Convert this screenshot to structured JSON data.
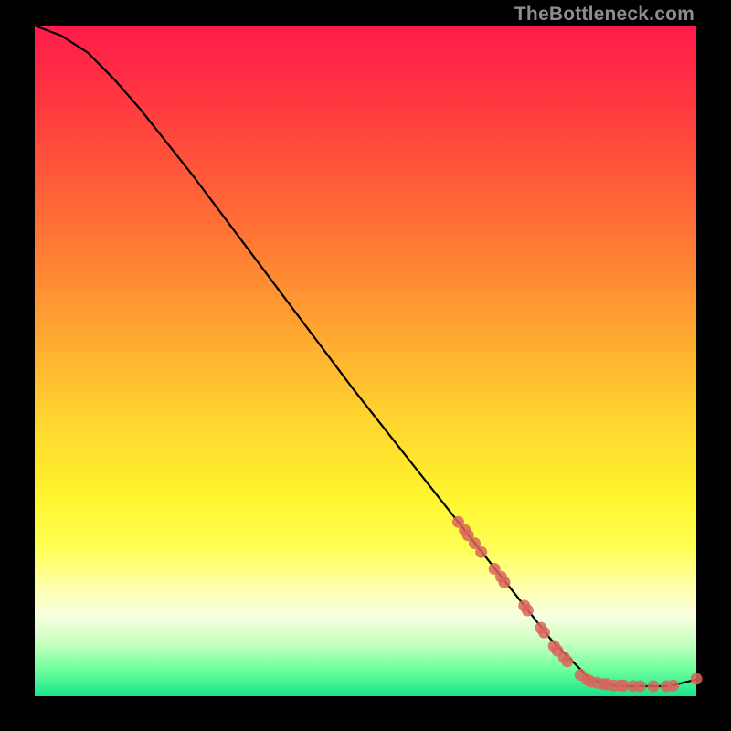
{
  "watermark": "TheBottleneck.com",
  "colors": {
    "curve": "#000000",
    "point": "#d9655a",
    "frame": "#000000"
  },
  "chart_data": {
    "type": "line",
    "title": "",
    "xlabel": "",
    "ylabel": "",
    "xlim": [
      0,
      100
    ],
    "ylim": [
      0,
      100
    ],
    "series": [
      {
        "name": "curve",
        "x": [
          0,
          4,
          8,
          12,
          16,
          24,
          32,
          40,
          48,
          56,
          64,
          72,
          78,
          84,
          88,
          92,
          96,
          100
        ],
        "y": [
          100,
          98.5,
          96,
          92,
          87.5,
          77.5,
          67,
          56.5,
          46,
          36,
          26,
          16,
          8.5,
          2.5,
          1.5,
          1.5,
          1.5,
          2.5
        ]
      }
    ],
    "scatter_points": [
      {
        "x": 64.0,
        "y": 26.0
      },
      {
        "x": 65.0,
        "y": 24.8
      },
      {
        "x": 65.5,
        "y": 24.0
      },
      {
        "x": 66.5,
        "y": 22.8
      },
      {
        "x": 67.5,
        "y": 21.5
      },
      {
        "x": 69.5,
        "y": 19.0
      },
      {
        "x": 70.5,
        "y": 17.8
      },
      {
        "x": 71.0,
        "y": 17.0
      },
      {
        "x": 74.0,
        "y": 13.5
      },
      {
        "x": 74.5,
        "y": 12.8
      },
      {
        "x": 76.5,
        "y": 10.2
      },
      {
        "x": 77.0,
        "y": 9.5
      },
      {
        "x": 78.5,
        "y": 7.5
      },
      {
        "x": 79.0,
        "y": 6.8
      },
      {
        "x": 80.0,
        "y": 5.8
      },
      {
        "x": 80.5,
        "y": 5.2
      },
      {
        "x": 82.5,
        "y": 3.2
      },
      {
        "x": 83.5,
        "y": 2.5
      },
      {
        "x": 84.0,
        "y": 2.2
      },
      {
        "x": 85.0,
        "y": 2.0
      },
      {
        "x": 86.0,
        "y": 1.8
      },
      {
        "x": 86.5,
        "y": 1.8
      },
      {
        "x": 87.5,
        "y": 1.6
      },
      {
        "x": 88.5,
        "y": 1.6
      },
      {
        "x": 89.0,
        "y": 1.6
      },
      {
        "x": 90.5,
        "y": 1.5
      },
      {
        "x": 91.5,
        "y": 1.5
      },
      {
        "x": 93.5,
        "y": 1.5
      },
      {
        "x": 95.5,
        "y": 1.5
      },
      {
        "x": 96.5,
        "y": 1.6
      },
      {
        "x": 100.0,
        "y": 2.6
      }
    ]
  }
}
